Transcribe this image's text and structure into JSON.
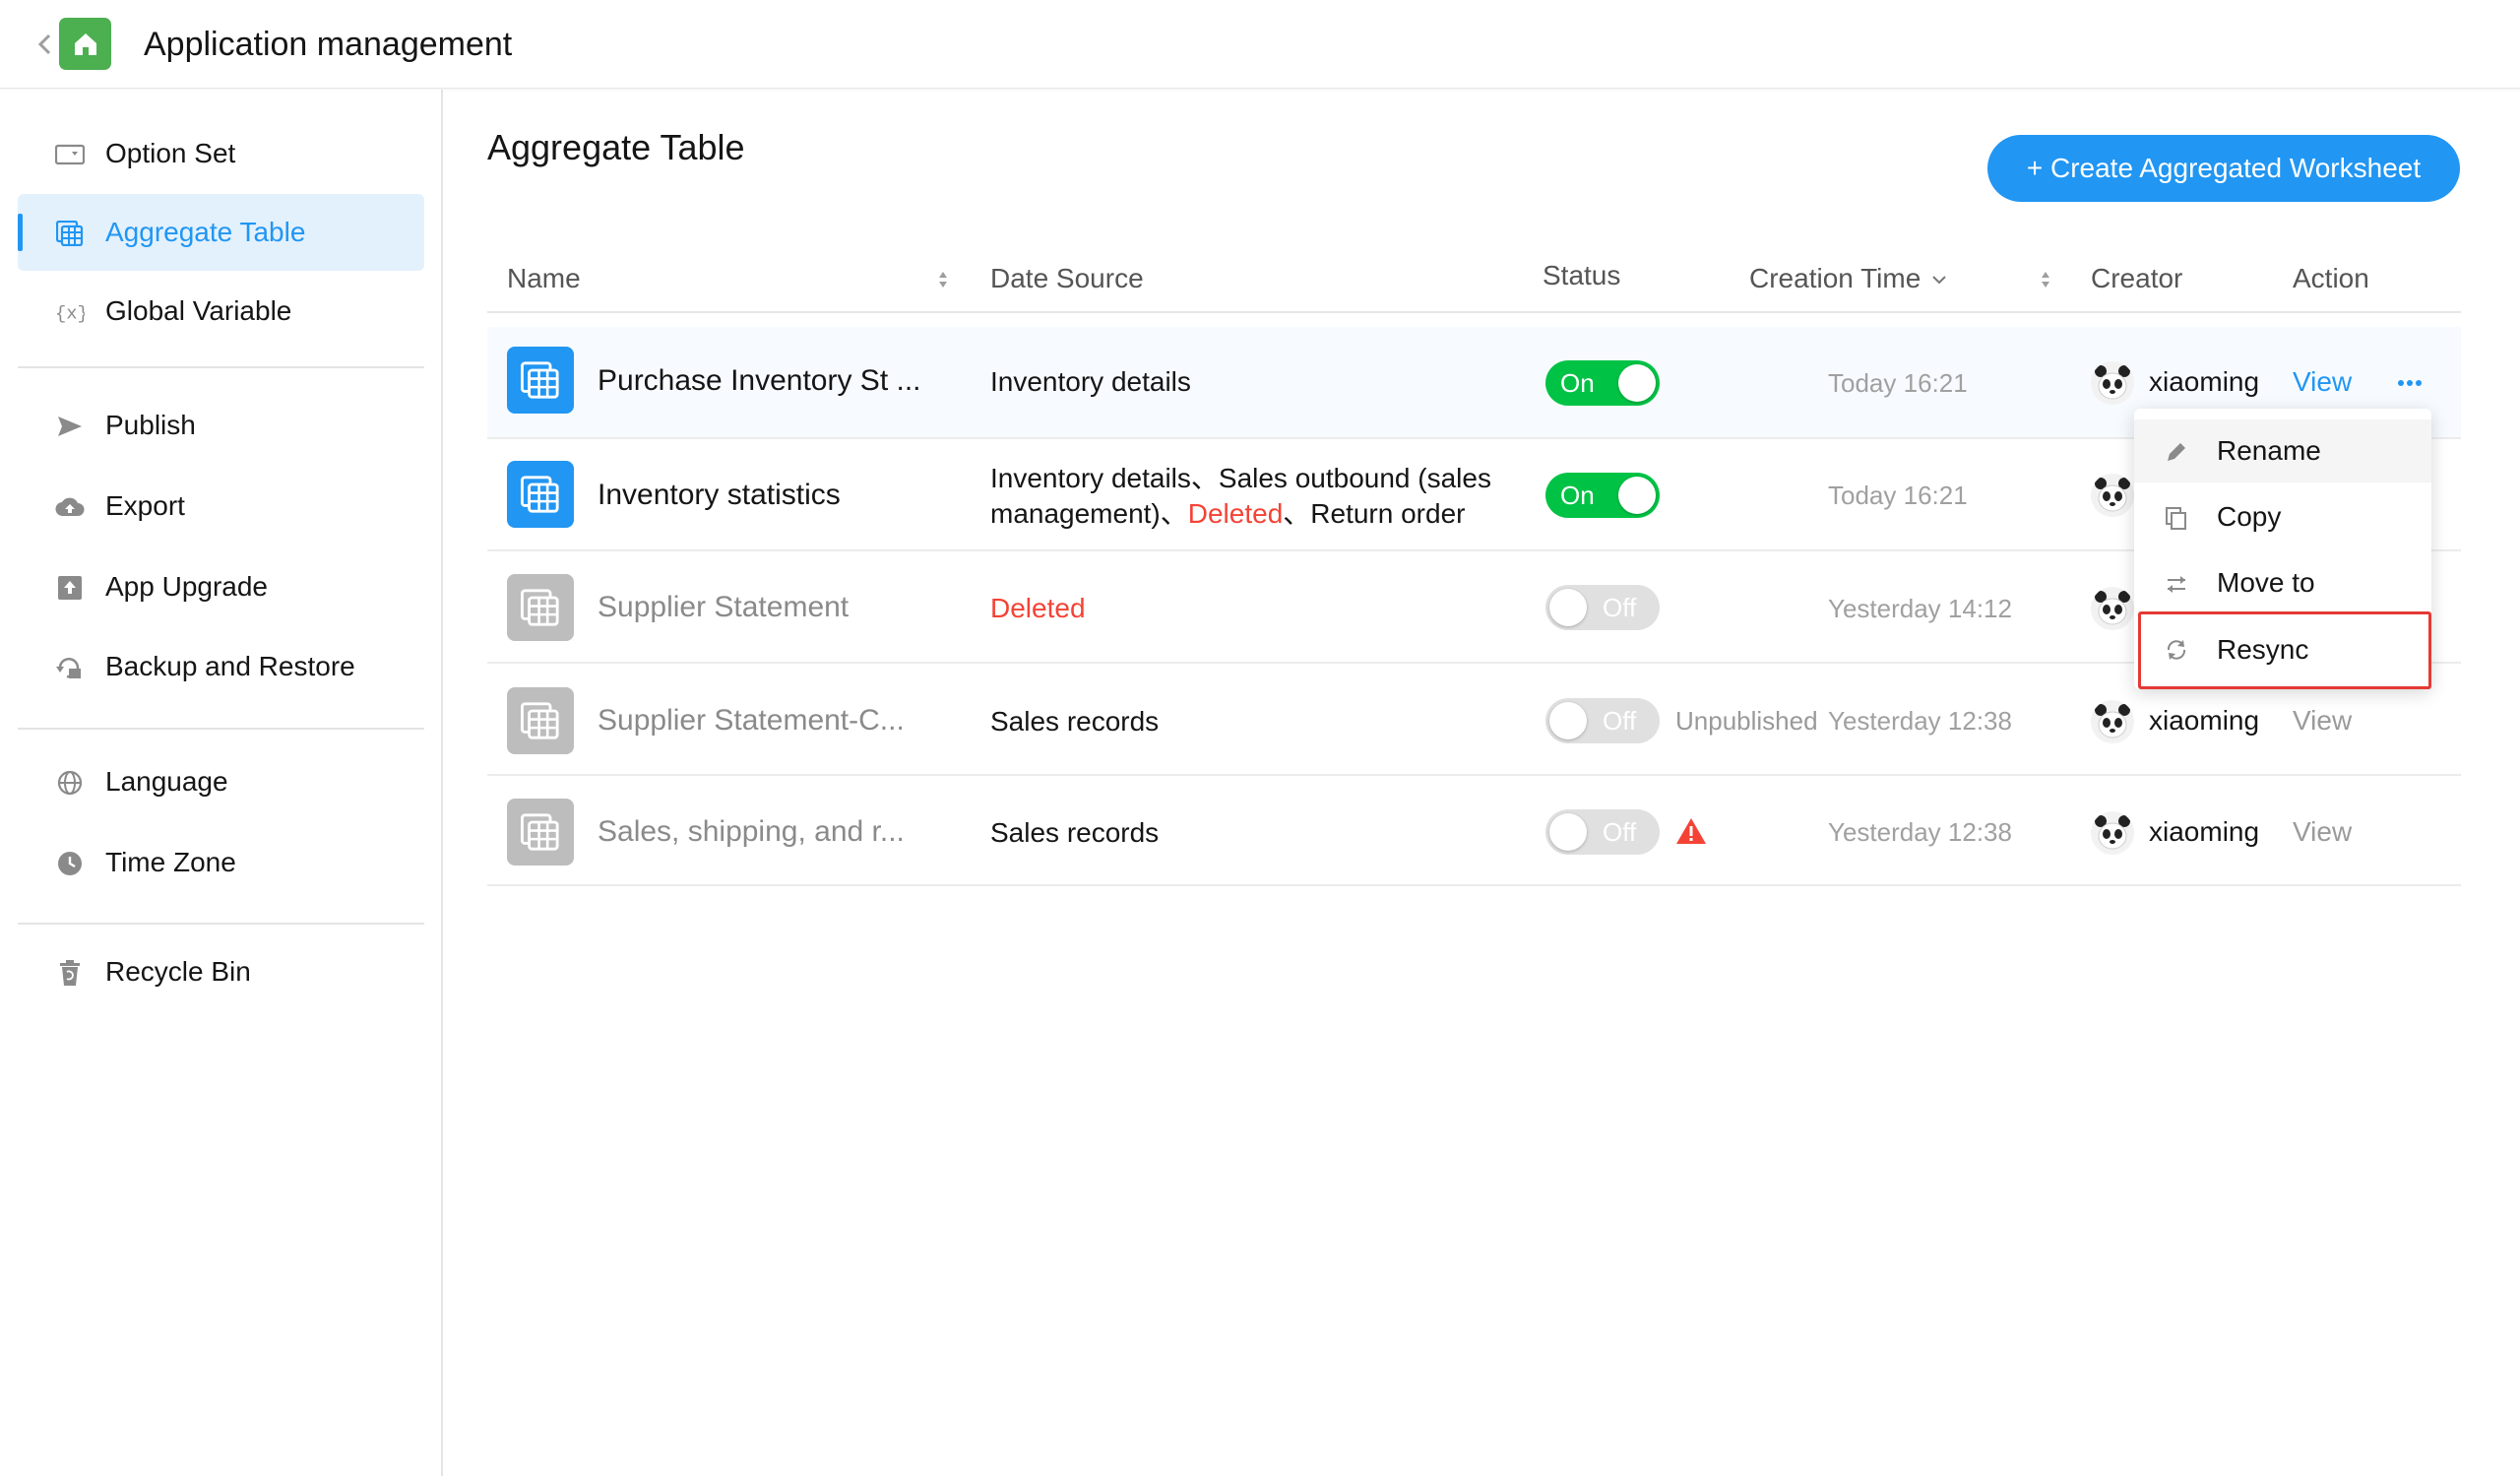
{
  "header": {
    "title": "Application management",
    "logo_color": "#4caf50"
  },
  "sidebar": {
    "items": [
      {
        "label": "Option Set",
        "icon": "option-set-icon"
      },
      {
        "label": "Aggregate Table",
        "icon": "aggregate-table-icon",
        "active": true
      },
      {
        "label": "Global Variable",
        "icon": "variable-icon"
      },
      {
        "label": "Publish",
        "icon": "send-icon"
      },
      {
        "label": "Export",
        "icon": "cloud-export-icon"
      },
      {
        "label": "App Upgrade",
        "icon": "upgrade-icon"
      },
      {
        "label": "Backup and Restore",
        "icon": "backup-icon"
      },
      {
        "label": "Language",
        "icon": "globe-icon"
      },
      {
        "label": "Time Zone",
        "icon": "clock-icon"
      },
      {
        "label": "Recycle Bin",
        "icon": "trash-icon"
      }
    ]
  },
  "main": {
    "title": "Aggregate Table",
    "create_button": "+ Create Aggregated Worksheet",
    "accent": "#2196f3"
  },
  "table": {
    "columns": {
      "name": "Name",
      "source": "Date Source",
      "status": "Status",
      "time": "Creation Time",
      "creator": "Creator",
      "action": "Action"
    },
    "rows": [
      {
        "name": "Purchase Inventory St ...",
        "source_parts": [
          "Inventory details"
        ],
        "status": "On",
        "time": "Today 16:21",
        "creator": "xiaoming",
        "action": "View"
      },
      {
        "name": "Inventory statistics",
        "source_parts": [
          "Inventory details、Sales outbound (sales management)、",
          "Deleted",
          "、Return order"
        ],
        "status": "On",
        "time": "Today 16:21",
        "creator": "",
        "action": ""
      },
      {
        "name": "Supplier Statement",
        "source_parts": [
          "Deleted"
        ],
        "status": "Off",
        "time": "Yesterday 14:12",
        "creator": "",
        "action": ""
      },
      {
        "name": "Supplier Statement-C...",
        "source_parts": [
          "Sales records"
        ],
        "status": "Off",
        "extra": "Unpublished",
        "time": "Yesterday 12:38",
        "creator": "xiaoming",
        "action": "View"
      },
      {
        "name": "Sales, shipping, and r...",
        "source_parts": [
          "Sales records"
        ],
        "status": "Off",
        "time": "Yesterday 12:38",
        "creator": "xiaoming",
        "action": "View"
      }
    ]
  },
  "menu": {
    "items": [
      {
        "label": "Rename",
        "icon": "pencil-icon"
      },
      {
        "label": "Copy",
        "icon": "copy-icon"
      },
      {
        "label": "Move to",
        "icon": "move-arrows-icon"
      },
      {
        "label": "Resync",
        "icon": "sync-icon"
      }
    ]
  }
}
